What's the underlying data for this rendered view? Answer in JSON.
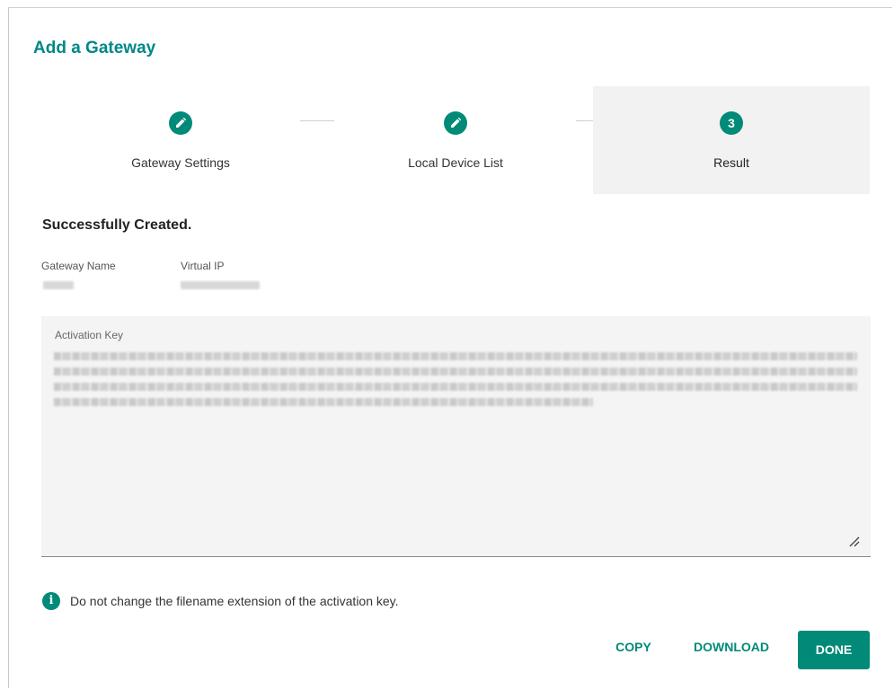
{
  "dialog": {
    "title": "Add a Gateway"
  },
  "stepper": {
    "steps": [
      {
        "label": "Gateway Settings",
        "state": "done",
        "icon": "pencil-icon"
      },
      {
        "label": "Local Device List",
        "state": "done",
        "icon": "pencil-icon"
      },
      {
        "label": "Result",
        "state": "active",
        "number": "3"
      }
    ]
  },
  "result": {
    "status": "Successfully Created.",
    "gateway_name_label": "Gateway Name",
    "virtual_ip_label": "Virtual IP",
    "activation_key_label": "Activation Key"
  },
  "info": {
    "icon": "info-icon",
    "message": "Do not change the filename extension of the activation key."
  },
  "actions": {
    "copy": "COPY",
    "download": "DOWNLOAD",
    "done": "DONE"
  },
  "colors": {
    "accent": "#008a77",
    "title": "#008787",
    "active_step_bg": "#f2f2f2"
  }
}
